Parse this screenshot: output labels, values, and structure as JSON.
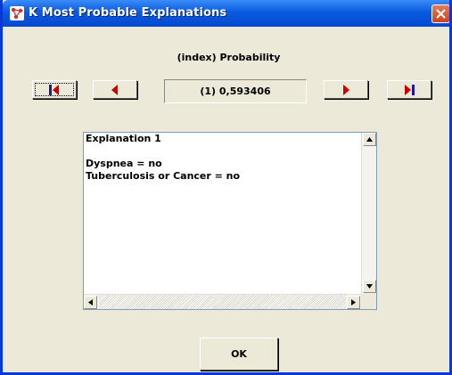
{
  "window": {
    "title": "K Most Probable Explanations",
    "icon": "network-icon",
    "close_icon": "close-icon"
  },
  "header": {
    "label": "(index) Probability"
  },
  "navigation": {
    "first_icon": "first-icon",
    "previous_icon": "previous-icon",
    "next_icon": "next-icon",
    "last_icon": "last-icon",
    "current_value": "(1) 0,593406"
  },
  "explanation": {
    "lines": [
      "Explanation 1",
      "",
      "Dyspnea = no",
      "Tuberculosis or Cancer = no"
    ]
  },
  "buttons": {
    "ok_label": "OK"
  },
  "colors": {
    "titlebar": "#0a5ae0",
    "nav_arrow": "#cc0000",
    "nav_bar": "#1a1aa0",
    "window_bg": "#ece9d8"
  }
}
